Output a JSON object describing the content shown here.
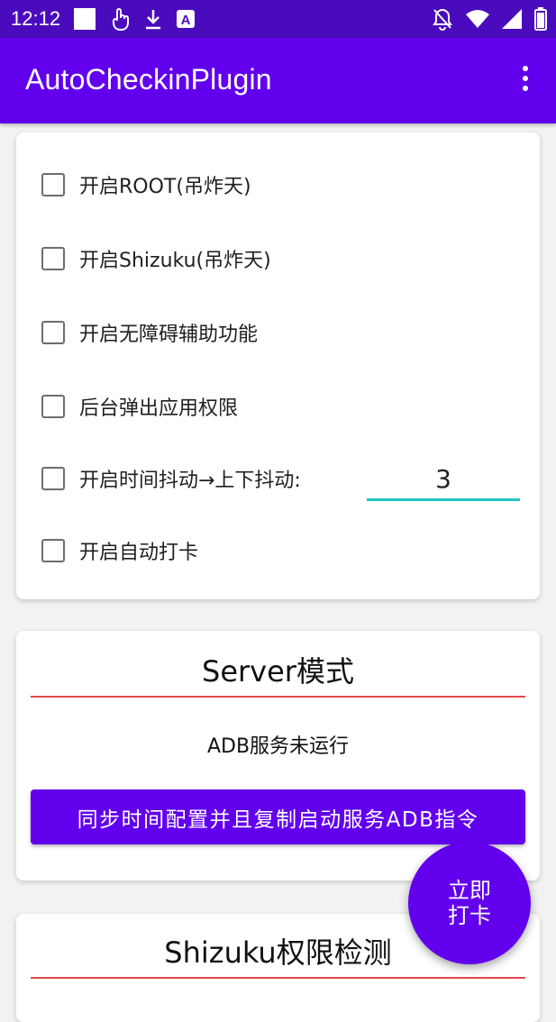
{
  "status_bar": {
    "time": "12:12",
    "icons": [
      "square-notification-icon",
      "touch-icon",
      "download-icon",
      "a-box-icon",
      "bell-off-icon",
      "wifi-icon",
      "signal-icon",
      "battery-icon"
    ]
  },
  "app_bar": {
    "title": "AutoCheckinPlugin",
    "overflow_icon": "more-vert-icon"
  },
  "settings_card": {
    "options": [
      {
        "label": "开启ROOT(吊炸天)",
        "checked": false
      },
      {
        "label": "开启Shizuku(吊炸天)",
        "checked": false
      },
      {
        "label": "开启无障碍辅助功能",
        "checked": false
      },
      {
        "label": "后台弹出应用权限",
        "checked": false
      },
      {
        "label": "开启时间抖动→上下抖动:",
        "checked": false
      },
      {
        "label": "开启自动打卡",
        "checked": false
      }
    ],
    "jitter_value": "3"
  },
  "server_card": {
    "title": "Server模式",
    "status": "ADB服务未运行",
    "button_label": "同步时间配置并且复制启动服务ADB指令"
  },
  "shizuku_card": {
    "title": "Shizuku权限检测"
  },
  "fab": {
    "line1": "立即",
    "line2": "打卡"
  },
  "colors": {
    "primary": "#6200ee",
    "status_bar": "#4a0bbd",
    "input_underline": "#1ec8c8",
    "divider_red": "#e24a4a"
  }
}
